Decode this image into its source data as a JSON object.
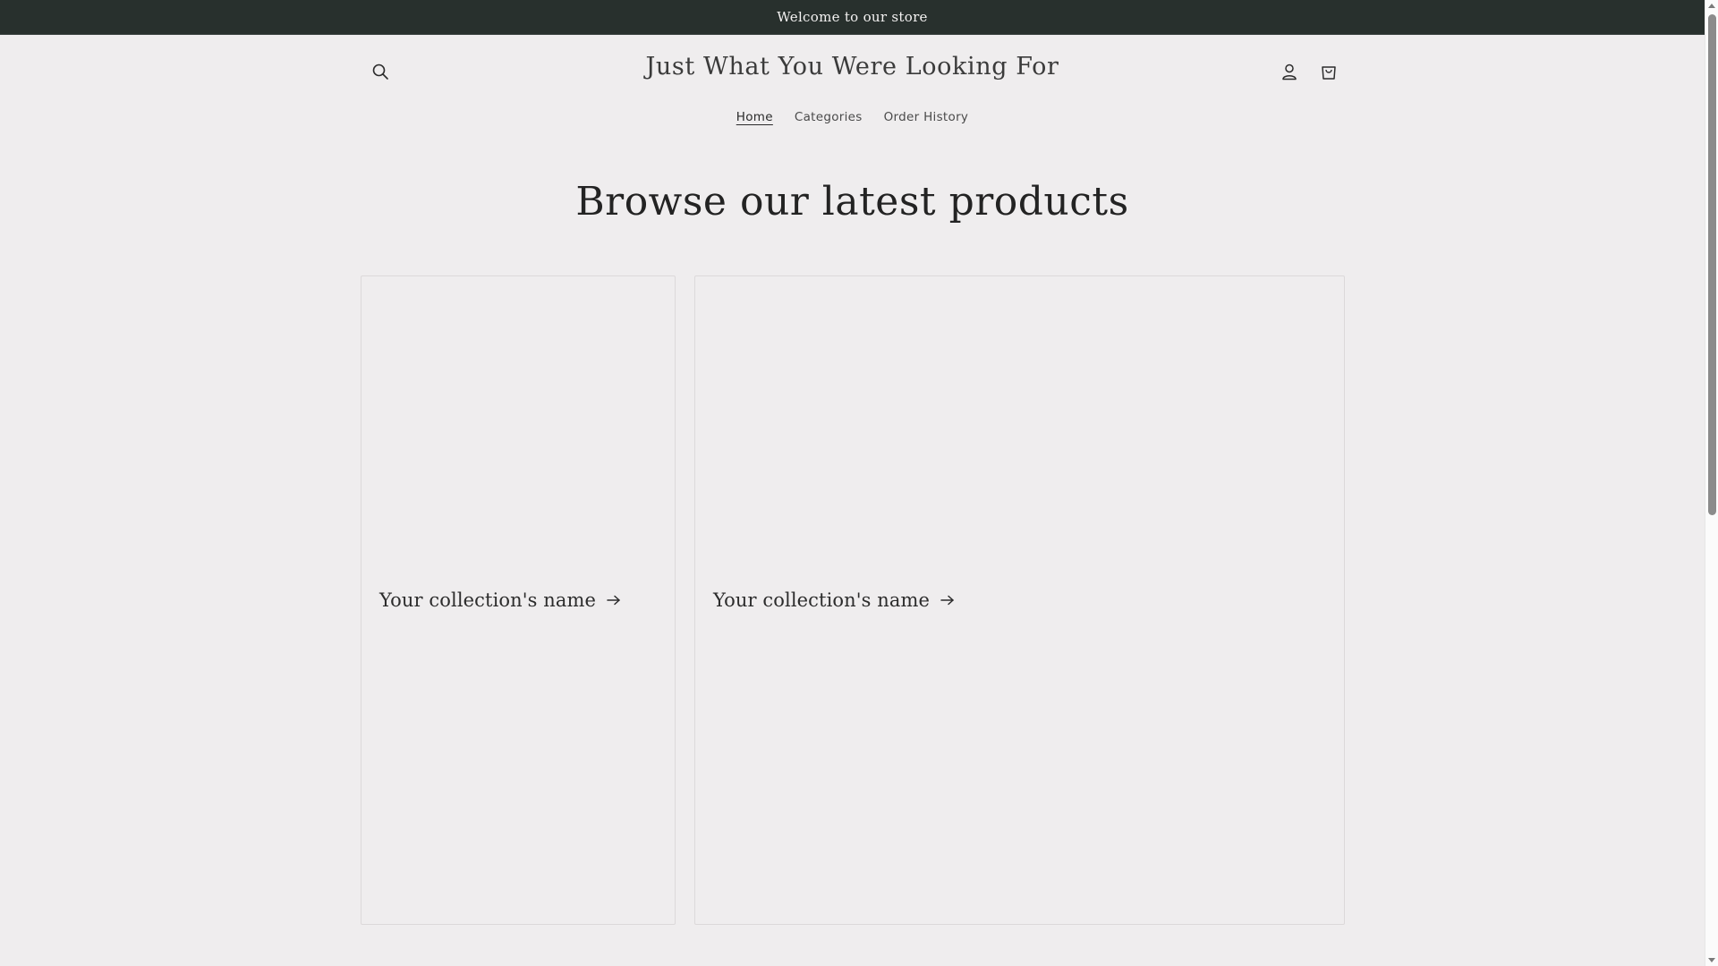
{
  "announcement": {
    "text": "Welcome to our store"
  },
  "header": {
    "store_title": "Just What You Were Looking For",
    "icons": {
      "search": "search-icon",
      "account": "user-icon",
      "cart": "shopping-bag-icon"
    }
  },
  "nav": {
    "items": [
      {
        "label": "Home",
        "active": true
      },
      {
        "label": "Categories",
        "active": false
      },
      {
        "label": "Order History",
        "active": false
      }
    ]
  },
  "main": {
    "heading": "Browse our latest products",
    "collections": [
      {
        "title": "Your collection's name",
        "icon": "arrow-right-icon"
      },
      {
        "title": "Your collection's name",
        "icon": "arrow-right-icon"
      }
    ]
  },
  "colors": {
    "announcement_bg": "#28302d",
    "page_bg": "#efedee",
    "text": "#232323"
  }
}
